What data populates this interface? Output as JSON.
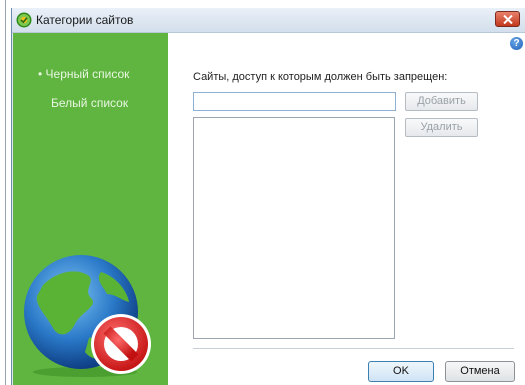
{
  "window": {
    "title": "Категории сайтов",
    "app_icon": "kaspersky-green-icon",
    "close_icon": "close-icon",
    "help_icon": "help-icon",
    "help_glyph": "?"
  },
  "sidebar": {
    "items": [
      {
        "label": "• Черный список",
        "active": true
      },
      {
        "label": "Белый список",
        "active": false
      }
    ],
    "illustration": "globe-blocked-icon"
  },
  "main": {
    "sites_label": "Сайты, доступ к которым должен быть запрещен:",
    "url_input_value": "",
    "add_button": "Добавить",
    "delete_button": "Удалить",
    "site_list": []
  },
  "footer": {
    "ok_button": "OK",
    "cancel_button": "Отмена"
  },
  "colors": {
    "sidebar_green": "#5fb540",
    "titlebar": "#dde6f0",
    "close_red": "#c3371c"
  }
}
